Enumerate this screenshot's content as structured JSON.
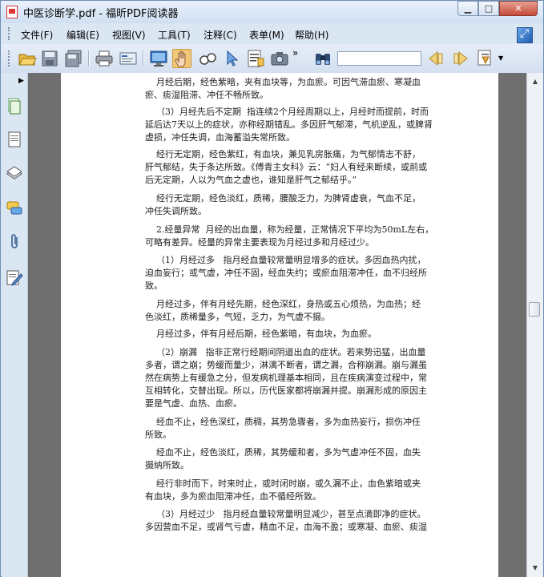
{
  "window": {
    "title": "中医诊断学.pdf - 福昕PDF阅读器",
    "min_label": "▁",
    "max_label": "□",
    "close_label": "✕"
  },
  "menu": {
    "items": [
      "文件(F)",
      "编辑(E)",
      "视图(V)",
      "工具(T)",
      "注释(C)",
      "表单(M)",
      "帮助(H)"
    ]
  },
  "toolbar": {
    "more_label": "»",
    "search_value": ""
  },
  "document": {
    "paragraphs": [
      "    月经后期，经色紫暗，夹有血块等，为血瘀。可因气滞血瘀、寒凝血\n瘀、痰湿阻滞、冲任不畅所致。",
      "    （3）月经先后不定期  指连续2个月经周期以上，月经时而提前，时而\n延后达7天以上的症状，亦称经期错乱。多因肝气郁滞，气机逆乱，或脾肾\n虚损，冲任失调，血海蓄溢失常所致。",
      "    经行无定期，经色紫红，有血块，兼见乳房胀痛，为气郁情志不舒，\n肝气郁结，失于条达所致。《傅青主女科》云：“妇人有经来断续，或前或\n后无定期，人以为气血之虚也，谁知是肝气之郁结乎。”",
      "    经行无定期，经色淡红，质稀，腰酸乏力，为脾肾虚衰，气血不足，\n冲任失调所致。",
      "    2.经量异常  月经的出血量，称为经量，正常情况下平均为50mL左右，\n可略有差异。经量的异常主要表现为月经过多和月经过少。",
      "    （1）月经过多   指月经血量较常量明显增多的症状。多因血热内扰，\n迫血妄行；或气虚，冲任不固，经血失约；或瘀血阻滞冲任，血不归经所\n致。",
      "    月经过多，伴有月经先期，经色深红，身热或五心烦热，为血热；经\n色淡红，质稀量多，气短，乏力，为气虚不摄。",
      "    月经过多，伴有月经后期，经色紫暗，有血块，为血瘀。",
      "    （2）崩漏   指非正常行经期间阴道出血的症状。若来势迅猛，出血量\n多者，谓之崩；势缓而量少，淋漓不断者，谓之漏，合称崩漏。崩与漏虽\n然在病势上有缓急之分，但发病机理基本相同，且在疾病演变过程中，常\n互相转化，交替出现。所以，历代医家都将崩漏并提。崩漏形成的原因主\n要是气虚、血热、血瘀。",
      "    经血不止，经色深红，质稠，其势急骤者，多为血热妄行，损伤冲任\n所致。",
      "    经血不止，经色淡红，质稀，其势缓和者，多为气虚冲任不固，血失\n摄纳所致。",
      "    经行非时而下，时来时止，或时闭时崩，或久漏不止，血色紫暗或夹\n有血块，多为瘀血阻滞冲任，血不循经所致。",
      "    （3）月经过少   指月经血量较常量明显减少，甚至点滴即净的症状。\n多因营血不足，或肾气亏虚，精血不足，血海不盈；或寒凝、血瘀、痰湿"
    ]
  }
}
